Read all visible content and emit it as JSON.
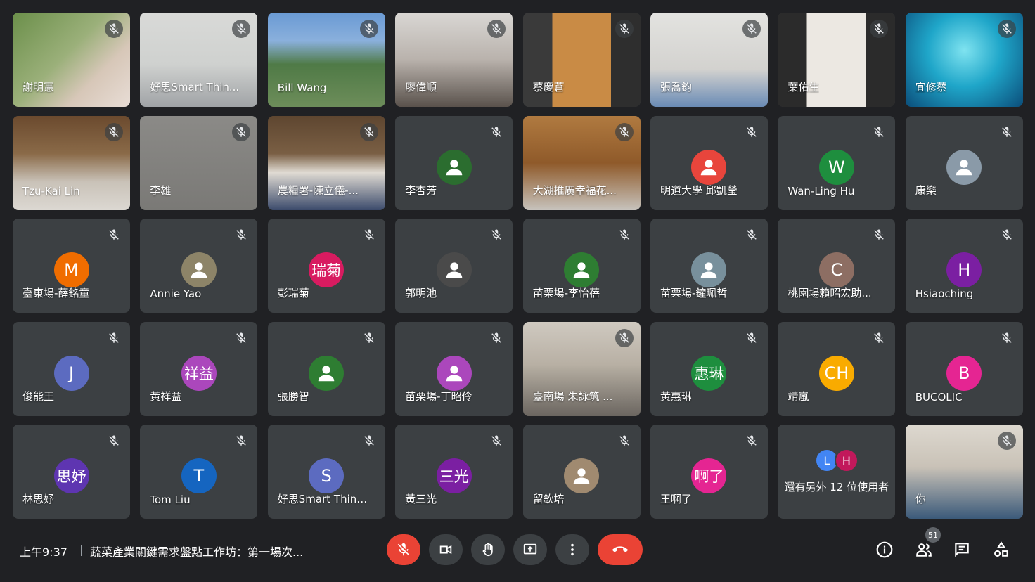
{
  "participants": [
    {
      "name": "謝明憲",
      "type": "video",
      "bg": "linear-gradient(135deg,#6b8f4a 0%,#9bb07a 45%,#d7c7b8 70%,#e8ddd6 100%)"
    },
    {
      "name": "好思Smart Thin...",
      "type": "video",
      "bg": "linear-gradient(180deg,#d9dad8 0%,#cfd1cf 55%,#a0a3a6 100%)"
    },
    {
      "name": "Bill Wang",
      "type": "video",
      "bg": "linear-gradient(180deg,#6a9ad4 0%,#8ab0dc 30%,#4f7a46 55%,#6d8d5a 100%)"
    },
    {
      "name": "廖偉順",
      "type": "video",
      "bg": "linear-gradient(180deg,#d9d7d4 0%,#b9b2ac 50%,#5a524c 100%)"
    },
    {
      "name": "蔡慶蒼",
      "type": "video",
      "bg": "linear-gradient(90deg,#3a3a3a 0%,#3a3a3a 25%,#c98b45 25%,#c98b45 75%,#2e2e2e 75%)"
    },
    {
      "name": "張喬鈞",
      "type": "video",
      "bg": "linear-gradient(180deg,#e3e3e0 0%,#d3d2cf 60%,#6a8bb5 100%)"
    },
    {
      "name": "葉佑生",
      "type": "video",
      "bg": "linear-gradient(90deg,#2b2b2b 0%,#2b2b2b 25%,#ece8e2 25%,#ece8e2 75%,#2b2b2b 75%)"
    },
    {
      "name": "宜修蔡",
      "type": "video",
      "bg": "radial-gradient(circle at 50% 40%,#7fe3f0 0%,#1fa6c9 45%,#0b4d7a 100%)"
    },
    {
      "name": "Tzu-Kai Lin",
      "type": "video",
      "bg": "linear-gradient(180deg,#6b4a2e 0%,#8a6a48 40%,#c9c2b8 70%,#dcd8d2 100%)"
    },
    {
      "name": "李雄",
      "type": "video",
      "bg": "linear-gradient(180deg,#8b8a87 0%,#7a7976 100%)"
    },
    {
      "name": "農糧署-陳立儀-...",
      "type": "video",
      "bg": "linear-gradient(180deg,#5e4630 0%,#7a5f44 40%,#e0dbd3 60%,#3b4a6b 100%)"
    },
    {
      "name": "李杏芳",
      "type": "avatar",
      "avatar_text": "",
      "avatar_color": "#2b6d2f"
    },
    {
      "name": "大湖推廣幸福花...",
      "type": "video",
      "bg": "linear-gradient(180deg,#b07a40 0%,#8f5a2a 50%,#c7c3bd 100%)"
    },
    {
      "name": "明道大學 邱凱瑩",
      "type": "avatar",
      "avatar_text": "",
      "avatar_color": "#e8453c"
    },
    {
      "name": "Wan-Ling Hu",
      "type": "avatar",
      "avatar_text": "W",
      "avatar_color": "#1e8e3e"
    },
    {
      "name": "康樂",
      "type": "avatar",
      "avatar_text": "",
      "avatar_color": "#8a9aa8"
    },
    {
      "name": "臺東場-薛銘童",
      "type": "avatar",
      "avatar_text": "M",
      "avatar_color": "#f06d00"
    },
    {
      "name": "Annie Yao",
      "type": "avatar",
      "avatar_text": "",
      "avatar_color": "#8d8468"
    },
    {
      "name": "彭瑞菊",
      "type": "avatar",
      "avatar_text": "瑞菊",
      "avatar_color": "#d81b60"
    },
    {
      "name": "郭明池",
      "type": "avatar",
      "avatar_text": "",
      "avatar_color": "#4a4a4a"
    },
    {
      "name": "苗栗場-李怡蓓",
      "type": "avatar",
      "avatar_text": "",
      "avatar_color": "#2e7d32"
    },
    {
      "name": "苗栗場-鐘珮哲",
      "type": "avatar",
      "avatar_text": "",
      "avatar_color": "#78909c"
    },
    {
      "name": "桃園場賴昭宏助...",
      "type": "avatar",
      "avatar_text": "C",
      "avatar_color": "#8d6e63"
    },
    {
      "name": "Hsiaoching",
      "type": "avatar",
      "avatar_text": "H",
      "avatar_color": "#7b1fa2"
    },
    {
      "name": "俊能王",
      "type": "avatar",
      "avatar_text": "J",
      "avatar_color": "#5c6bc0"
    },
    {
      "name": "黃祥益",
      "type": "avatar",
      "avatar_text": "祥益",
      "avatar_color": "#ab47bc"
    },
    {
      "name": "張勝智",
      "type": "avatar",
      "avatar_text": "",
      "avatar_color": "#2e7d32"
    },
    {
      "name": "苗栗場-丁昭伶",
      "type": "avatar",
      "avatar_text": "",
      "avatar_color": "#ab47bc"
    },
    {
      "name": "臺南場 朱詠筑 ...",
      "type": "video",
      "bg": "linear-gradient(180deg,#cfc9c0 0%,#b8b0a4 45%,#6b6660 100%)"
    },
    {
      "name": "黃惠琳",
      "type": "avatar",
      "avatar_text": "惠琳",
      "avatar_color": "#1e8e3e"
    },
    {
      "name": "靖嵐",
      "type": "avatar",
      "avatar_text": "CH",
      "avatar_color": "#f9ab00"
    },
    {
      "name": "BUCOLIC",
      "type": "avatar",
      "avatar_text": "B",
      "avatar_color": "#e52592"
    },
    {
      "name": "林思妤",
      "type": "avatar",
      "avatar_text": "思妤",
      "avatar_color": "#5e35b1"
    },
    {
      "name": "Tom Liu",
      "type": "avatar",
      "avatar_text": "T",
      "avatar_color": "#1565c0"
    },
    {
      "name": "好思Smart Thinki...",
      "type": "avatar",
      "avatar_text": "S",
      "avatar_color": "#5c6bc0"
    },
    {
      "name": "黃三光",
      "type": "avatar",
      "avatar_text": "三光",
      "avatar_color": "#7b1fa2"
    },
    {
      "name": "留欽培",
      "type": "avatar",
      "avatar_text": "",
      "avatar_color": "#a08a70"
    },
    {
      "name": "王啊了",
      "type": "avatar",
      "avatar_text": "啊了",
      "avatar_color": "#e52592"
    },
    {
      "name": "",
      "type": "overflow"
    },
    {
      "name": "你",
      "type": "video",
      "bg": "linear-gradient(180deg,#ddd8cf 0%,#c9c2b7 45%,#3b5a7a 100%)"
    }
  ],
  "overflow_tile": {
    "label": "還有另外 12 位使用者",
    "avatars": [
      {
        "text": "L",
        "color": "#4285f4"
      },
      {
        "text": "H",
        "color": "#c2185b"
      }
    ]
  },
  "bottom_bar": {
    "time": "上午9:37",
    "separator": "|",
    "meeting_title": "蔬菜產業關鍵需求盤點工作坊：第一場次...",
    "participant_count": "51"
  },
  "icons": {
    "mic_off": "mic-off-icon",
    "camera": "videocam-icon",
    "hand": "raise-hand-icon",
    "present": "present-screen-icon",
    "more": "more-vert-icon",
    "end": "call-end-icon",
    "info": "info-icon",
    "people": "people-icon",
    "chat": "chat-icon",
    "activities": "activities-icon"
  },
  "colors": {
    "background": "#202124",
    "tile": "#3c4043",
    "red": "#ea4335"
  }
}
